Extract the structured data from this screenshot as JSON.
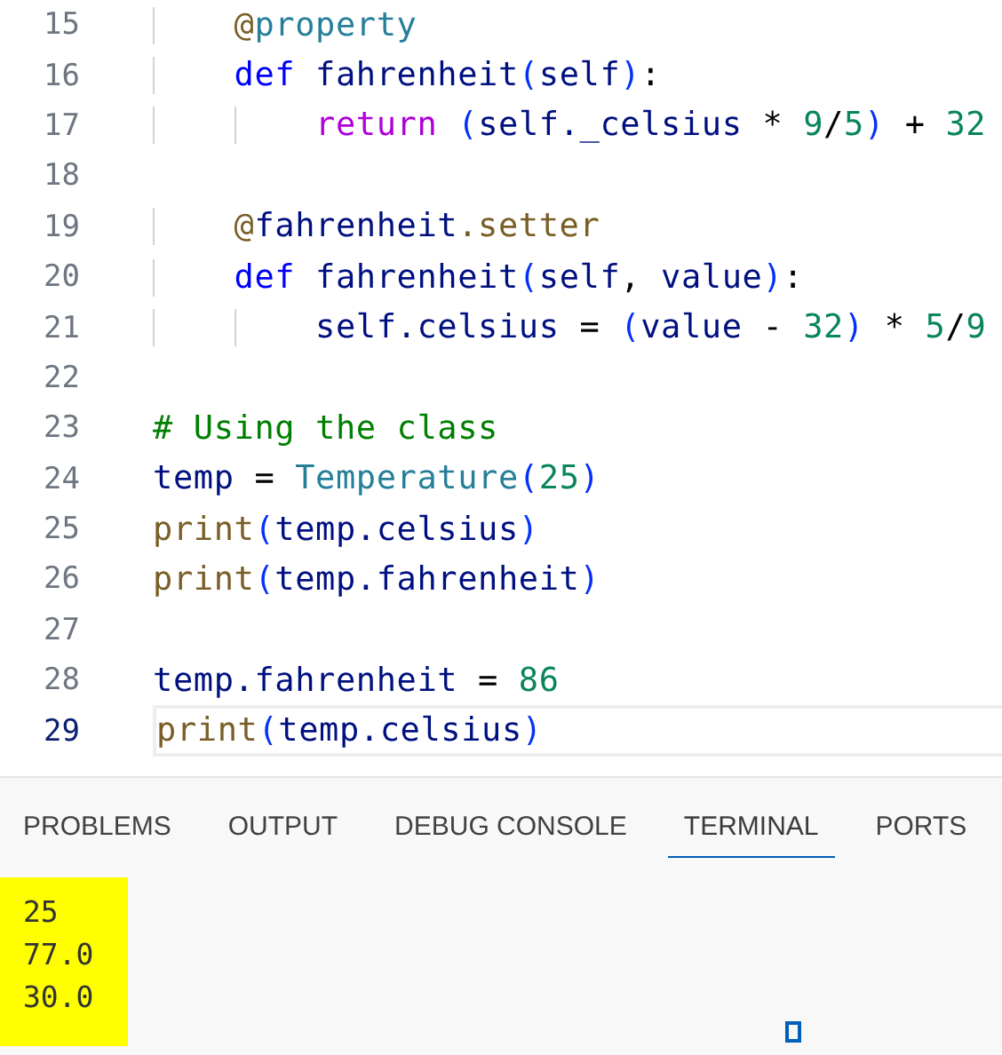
{
  "editor": {
    "lines": [
      {
        "number": "15",
        "current": false,
        "tokens": [
          {
            "kind": "decorator",
            "text": "    @"
          },
          {
            "kind": "type",
            "text": "property"
          }
        ]
      },
      {
        "number": "16",
        "current": false,
        "tokens": [
          {
            "kind": "keyword",
            "text": "    def "
          },
          {
            "kind": "variable",
            "text": "fahrenheit"
          },
          {
            "kind": "paren",
            "text": "("
          },
          {
            "kind": "variable",
            "text": "self"
          },
          {
            "kind": "paren",
            "text": ")"
          },
          {
            "kind": "plain",
            "text": ":"
          }
        ]
      },
      {
        "number": "17",
        "current": false,
        "tokens": [
          {
            "kind": "control",
            "text": "        return "
          },
          {
            "kind": "paren",
            "text": "("
          },
          {
            "kind": "variable",
            "text": "self._celsius"
          },
          {
            "kind": "plain",
            "text": " * "
          },
          {
            "kind": "number",
            "text": "9"
          },
          {
            "kind": "plain",
            "text": "/"
          },
          {
            "kind": "number",
            "text": "5"
          },
          {
            "kind": "paren",
            "text": ")"
          },
          {
            "kind": "plain",
            "text": " + "
          },
          {
            "kind": "number",
            "text": "32"
          }
        ]
      },
      {
        "number": "18",
        "current": false
      },
      {
        "number": "19",
        "current": false,
        "tokens": [
          {
            "kind": "decorator",
            "text": "    @"
          },
          {
            "kind": "variable",
            "text": "fahrenheit"
          },
          {
            "kind": "decorator",
            "text": ".setter"
          }
        ]
      },
      {
        "number": "20",
        "current": false,
        "tokens": [
          {
            "kind": "keyword",
            "text": "    def "
          },
          {
            "kind": "variable",
            "text": "fahrenheit"
          },
          {
            "kind": "paren",
            "text": "("
          },
          {
            "kind": "variable",
            "text": "self"
          },
          {
            "kind": "plain",
            "text": ", "
          },
          {
            "kind": "variable",
            "text": "value"
          },
          {
            "kind": "paren",
            "text": ")"
          },
          {
            "kind": "plain",
            "text": ":"
          }
        ]
      },
      {
        "number": "21",
        "current": false,
        "tokens": [
          {
            "kind": "variable",
            "text": "        self.celsius"
          },
          {
            "kind": "plain",
            "text": " = "
          },
          {
            "kind": "paren",
            "text": "("
          },
          {
            "kind": "variable",
            "text": "value"
          },
          {
            "kind": "plain",
            "text": " - "
          },
          {
            "kind": "number",
            "text": "32"
          },
          {
            "kind": "paren",
            "text": ")"
          },
          {
            "kind": "plain",
            "text": " * "
          },
          {
            "kind": "number",
            "text": "5"
          },
          {
            "kind": "plain",
            "text": "/"
          },
          {
            "kind": "number",
            "text": "9"
          }
        ]
      },
      {
        "number": "22",
        "current": false
      },
      {
        "number": "23",
        "current": false,
        "tokens": [
          {
            "kind": "comment",
            "text": "# Using the class"
          }
        ]
      },
      {
        "number": "24",
        "current": false,
        "tokens": [
          {
            "kind": "variable",
            "text": "temp"
          },
          {
            "kind": "plain",
            "text": " = "
          },
          {
            "kind": "type",
            "text": "Temperature"
          },
          {
            "kind": "paren",
            "text": "("
          },
          {
            "kind": "number",
            "text": "25"
          },
          {
            "kind": "paren",
            "text": ")"
          }
        ]
      },
      {
        "number": "25",
        "current": false,
        "tokens": [
          {
            "kind": "function",
            "text": "print"
          },
          {
            "kind": "paren",
            "text": "("
          },
          {
            "kind": "variable",
            "text": "temp.celsius"
          },
          {
            "kind": "paren",
            "text": ")"
          }
        ]
      },
      {
        "number": "26",
        "current": false,
        "tokens": [
          {
            "kind": "function",
            "text": "print"
          },
          {
            "kind": "paren",
            "text": "("
          },
          {
            "kind": "variable",
            "text": "temp.fahrenheit"
          },
          {
            "kind": "paren",
            "text": ")"
          }
        ]
      },
      {
        "number": "27",
        "current": false
      },
      {
        "number": "28",
        "current": false,
        "tokens": [
          {
            "kind": "variable",
            "text": "temp.fahrenheit"
          },
          {
            "kind": "plain",
            "text": " = "
          },
          {
            "kind": "number",
            "text": "86"
          }
        ]
      },
      {
        "number": "29",
        "current": true,
        "tokens": [
          {
            "kind": "function",
            "text": "print"
          },
          {
            "kind": "paren",
            "text": "("
          },
          {
            "kind": "variable",
            "text": "temp.celsius"
          },
          {
            "kind": "paren",
            "text": ")"
          }
        ]
      }
    ]
  },
  "panel": {
    "tabs": [
      {
        "label": "PROBLEMS",
        "selected": false
      },
      {
        "label": "OUTPUT",
        "selected": false
      },
      {
        "label": "DEBUG CONSOLE",
        "selected": false
      },
      {
        "label": "TERMINAL",
        "selected": true
      },
      {
        "label": "PORTS",
        "selected": false
      }
    ],
    "terminal_output": [
      "25",
      "77.0",
      "30.0"
    ]
  }
}
